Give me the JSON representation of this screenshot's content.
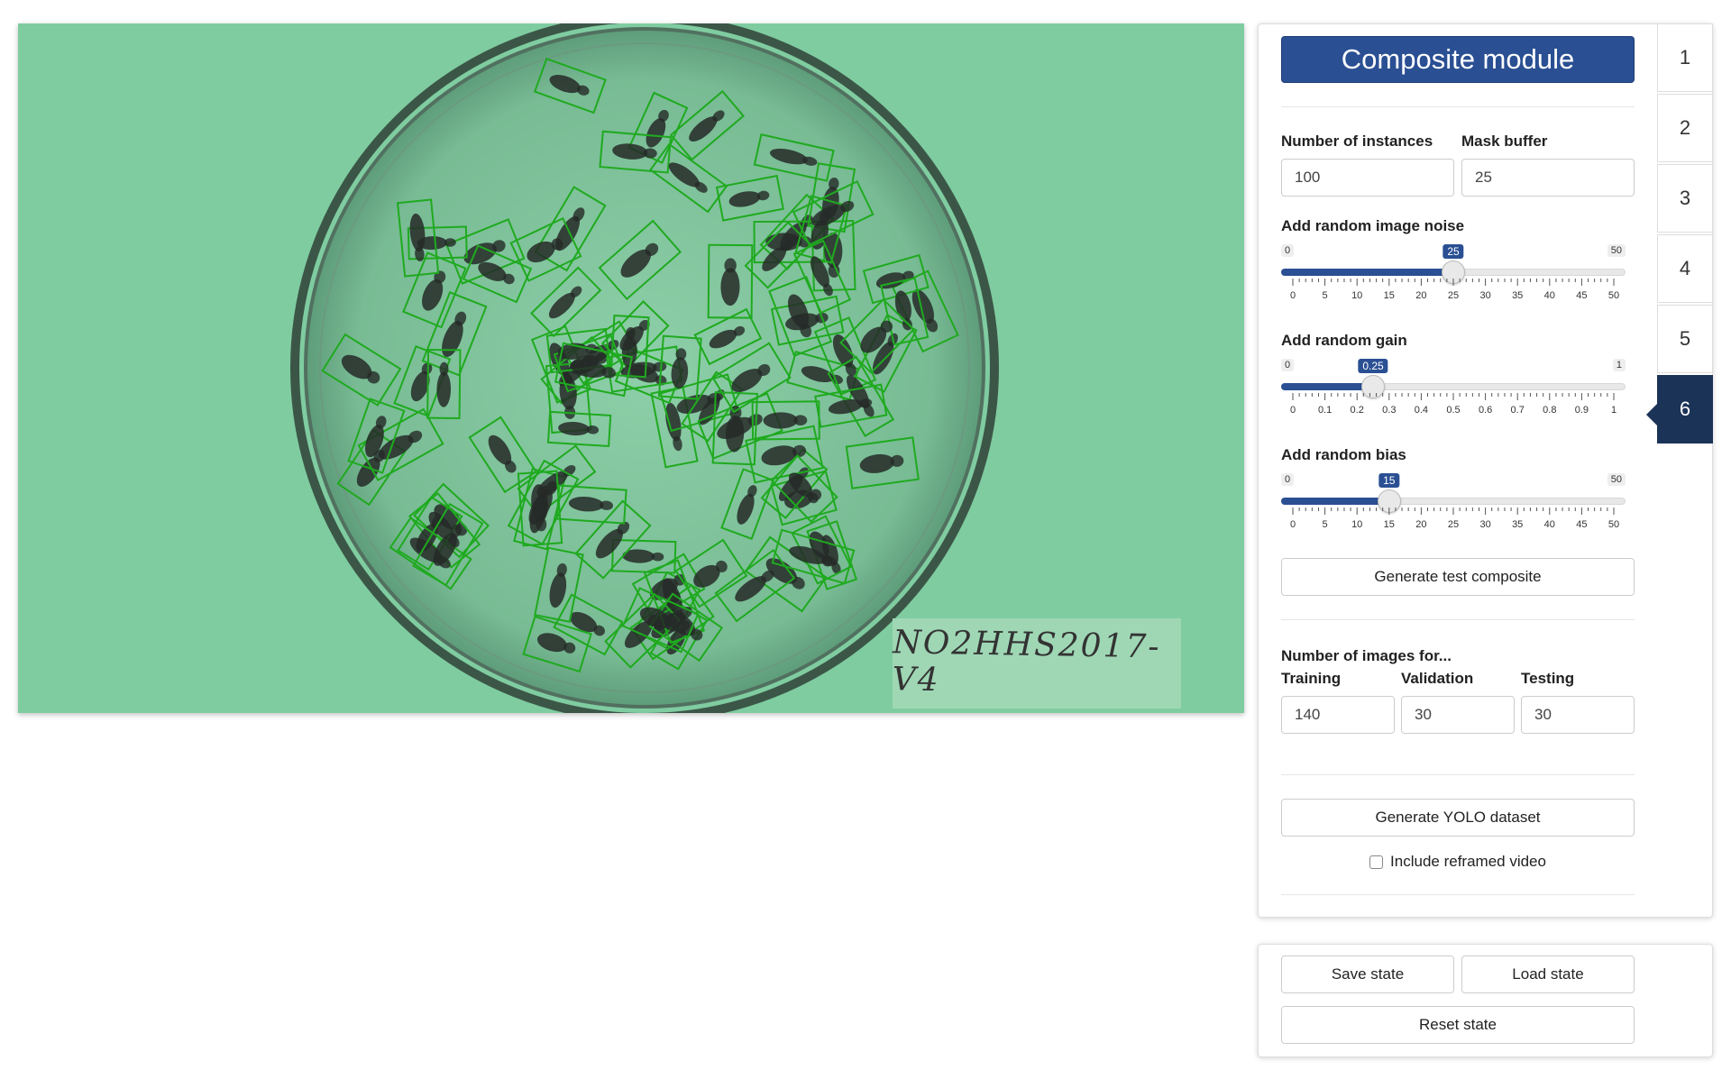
{
  "viewer": {
    "plate_label": "NO2HHS2017-V4",
    "colors": {
      "background": "#7fcca0",
      "dish_fill": "#7cbf98",
      "dish_rim": "#3b5647",
      "box_stroke": "#1faa1f",
      "animal": "#262a28"
    }
  },
  "panel": {
    "title": "Composite module",
    "instances_label": "Number of instances",
    "instances_value": "100",
    "mask_buffer_label": "Mask buffer",
    "mask_buffer_value": "25",
    "noise": {
      "label": "Add random image noise",
      "min": 0,
      "max": 50,
      "value": 25,
      "min_label": "0",
      "max_label": "50",
      "value_label": "25",
      "ticks": [
        "0",
        "5",
        "10",
        "15",
        "20",
        "25",
        "30",
        "35",
        "40",
        "45",
        "50"
      ]
    },
    "gain": {
      "label": "Add random gain",
      "min": 0,
      "max": 1,
      "value": 0.25,
      "min_label": "0",
      "max_label": "1",
      "value_label": "0.25",
      "ticks": [
        "0",
        "0.1",
        "0.2",
        "0.3",
        "0.4",
        "0.5",
        "0.6",
        "0.7",
        "0.8",
        "0.9",
        "1"
      ]
    },
    "bias": {
      "label": "Add random bias",
      "min": 0,
      "max": 50,
      "value": 15,
      "min_label": "0",
      "max_label": "50",
      "value_label": "15",
      "ticks": [
        "0",
        "5",
        "10",
        "15",
        "20",
        "25",
        "30",
        "35",
        "40",
        "45",
        "50"
      ]
    },
    "generate_test_label": "Generate test composite",
    "images_for_label": "Number of images for...",
    "training_label": "Training",
    "training_value": "140",
    "validation_label": "Validation",
    "validation_value": "30",
    "testing_label": "Testing",
    "testing_value": "30",
    "generate_yolo_label": "Generate YOLO dataset",
    "include_video_label": "Include reframed video",
    "include_video_checked": false,
    "accent_color": "#2a4f93"
  },
  "tabs": [
    {
      "label": "1",
      "active": false
    },
    {
      "label": "2",
      "active": false
    },
    {
      "label": "3",
      "active": false
    },
    {
      "label": "4",
      "active": false
    },
    {
      "label": "5",
      "active": false
    },
    {
      "label": "6",
      "active": true
    }
  ],
  "state": {
    "save_label": "Save state",
    "load_label": "Load state",
    "reset_label": "Reset state"
  }
}
